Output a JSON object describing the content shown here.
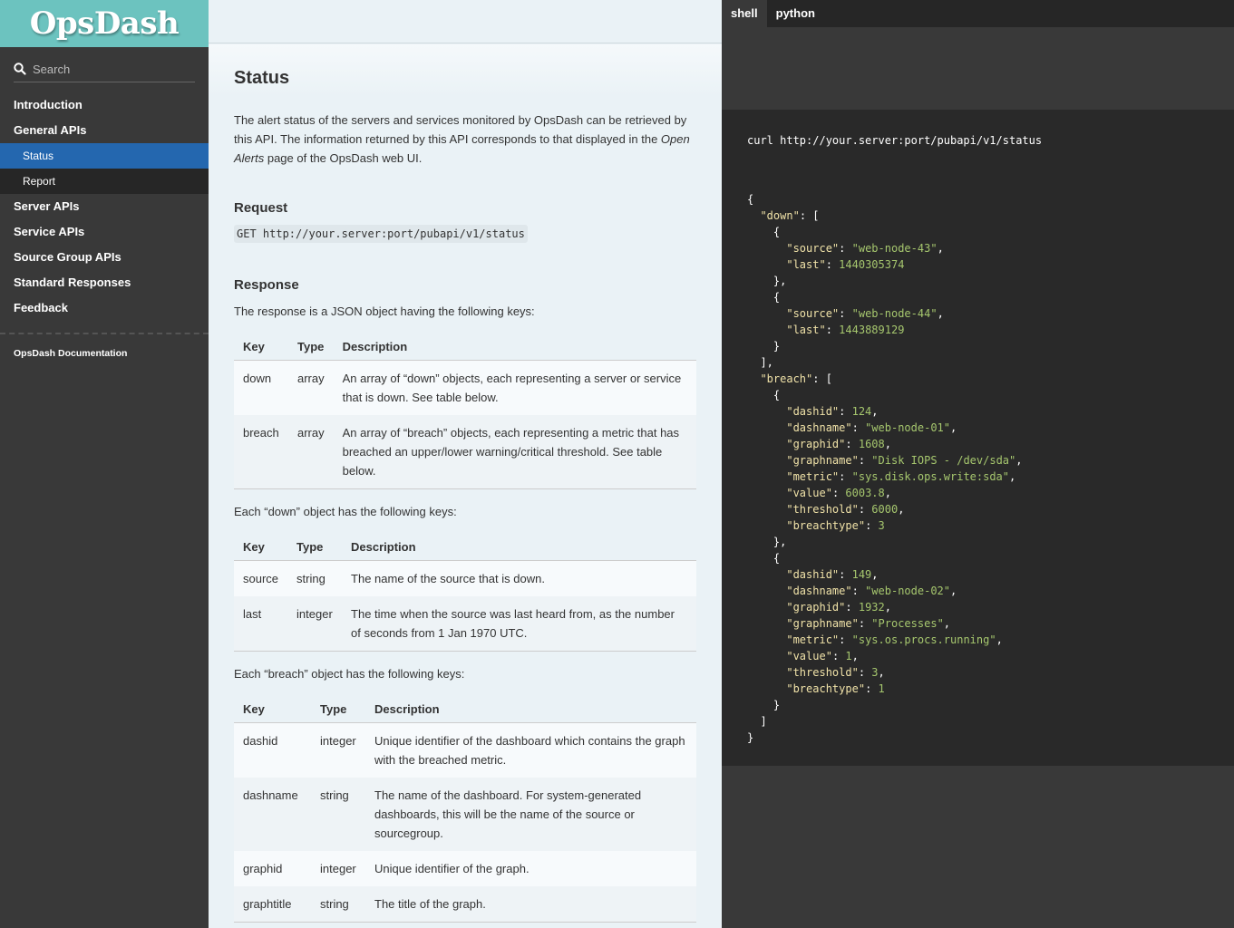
{
  "sidebar": {
    "logo": "OpsDash",
    "search_placeholder": "Search",
    "items": [
      {
        "label": "Introduction"
      },
      {
        "label": "General APIs"
      },
      {
        "label": "Status"
      },
      {
        "label": "Report"
      },
      {
        "label": "Server APIs"
      },
      {
        "label": "Service APIs"
      },
      {
        "label": "Source Group APIs"
      },
      {
        "label": "Standard Responses"
      },
      {
        "label": "Feedback"
      }
    ],
    "footer": "OpsDash Documentation"
  },
  "main": {
    "title": "Status",
    "intro_1": "The alert status of the servers and services monitored by OpsDash can be retrieved by this API. The information returned by this API corresponds to that displayed in the ",
    "intro_em": "Open Alerts",
    "intro_2": " page of the OpsDash web UI.",
    "request_heading": "Request",
    "request_code": "GET http://your.server:port/pubapi/v1/status",
    "response_heading": "Response",
    "response_intro": "The response is a JSON object having the following keys:",
    "headers": {
      "key": "Key",
      "type": "Type",
      "description": "Description"
    },
    "table1": [
      {
        "key": "down",
        "type": "array",
        "desc": "An array of “down” objects, each representing a server or service that is down. See table below."
      },
      {
        "key": "breach",
        "type": "array",
        "desc": "An array of “breach” objects, each representing a metric that has breached an upper/lower warning/critical threshold. See table below."
      }
    ],
    "down_intro": "Each “down” object has the following keys:",
    "table2": [
      {
        "key": "source",
        "type": "string",
        "desc": "The name of the source that is down."
      },
      {
        "key": "last",
        "type": "integer",
        "desc": "The time when the source was last heard from, as the number of seconds from 1 Jan 1970 UTC."
      }
    ],
    "breach_intro": "Each “breach” object has the following keys:",
    "table3": [
      {
        "key": "dashid",
        "type": "integer",
        "desc": "Unique identifier of the dashboard which contains the graph with the breached metric."
      },
      {
        "key": "dashname",
        "type": "string",
        "desc": "The name of the dashboard. For system-generated dashboards, this will be the name of the source or sourcegroup."
      },
      {
        "key": "graphid",
        "type": "integer",
        "desc": "Unique identifier of the graph."
      },
      {
        "key": "graphtitle",
        "type": "string",
        "desc": "The title of the graph."
      }
    ]
  },
  "code": {
    "tabs": [
      {
        "label": "shell"
      },
      {
        "label": "python"
      }
    ],
    "curl": "curl http://your.server:port/pubapi/v1/status",
    "down": [
      {
        "source": "web-node-43",
        "last": "1440305374"
      },
      {
        "source": "web-node-44",
        "last": "1443889129"
      }
    ],
    "breach": [
      {
        "dashid": "124",
        "dashname": "web-node-01",
        "graphid": "1608",
        "graphname": "Disk IOPS - /dev/sda",
        "metric": "sys.disk.ops.write:sda",
        "value": "6003.8",
        "threshold": "6000",
        "breachtype": "3"
      },
      {
        "dashid": "149",
        "dashname": "web-node-02",
        "graphid": "1932",
        "graphname": "Processes",
        "metric": "sys.os.procs.running",
        "value": "1",
        "threshold": "3",
        "breachtype": "1"
      }
    ]
  }
}
